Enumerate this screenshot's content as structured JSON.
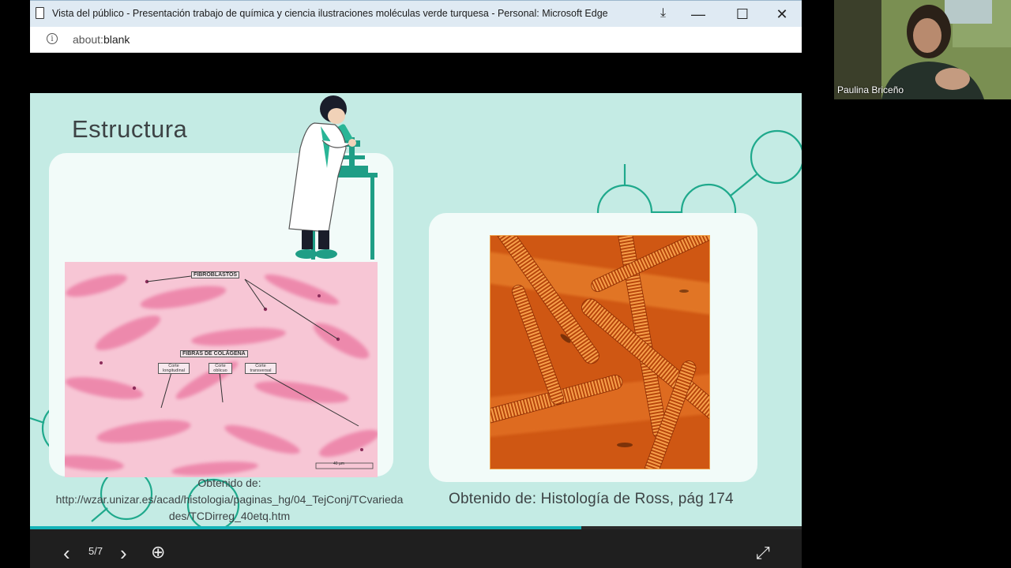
{
  "browser": {
    "window_title": "Vista del público - Presentación trabajo de química y ciencia ilustraciones moléculas verde turquesa - Personal: Microsoft Edge",
    "url_prefix": "about:",
    "url_main": "blank",
    "minimize_glyph": "—",
    "maximize_glyph": "☐",
    "close_glyph": "✕",
    "download_glyph": "⤓"
  },
  "slide": {
    "title": "Estructura",
    "histology_labels": {
      "fibroblastos": "FIBROBLASTOS",
      "fibras": "FIBRAS DE COLÁGENA",
      "corte_longitudinal": "Corte longitudinal",
      "corte_oblicuo": "Corte oblicuo",
      "corte_transversal": "Corte transversal",
      "scale": "40 µm"
    },
    "credit_left_line1": "Obtenido de:",
    "credit_left_line2": "http://wzar.unizar.es/acad/histologia/paginas_hg/04_TejConj/TCvarieda",
    "credit_left_line3": "des/TCDirreg_40etq.htm",
    "credit_right": "Obtenido de: Histología de Ross, pág 174"
  },
  "player": {
    "counter": "5/7",
    "progress": 0.714,
    "prev_glyph": "‹",
    "next_glyph": "›",
    "zoom_glyph": "⊕",
    "fullscreen_glyph": "⤢"
  },
  "participant": {
    "name": "Paulina Briceño"
  },
  "colors": {
    "slide_bg": "#c4ebe4",
    "accent": "#14b3b8",
    "deco": "#1fa98c"
  }
}
